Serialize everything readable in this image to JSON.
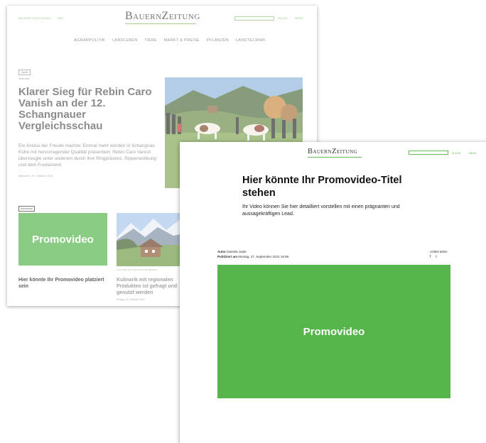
{
  "homepage": {
    "toplinks": [
      "BAUERN ZUSCHAUEN",
      "ABO"
    ],
    "logo": "BauernZeitung",
    "search_label": "SUCHE",
    "menu_label": "MENÜ",
    "nav": [
      "AGRARPOLITIK",
      "LANDLEBEN",
      "TIERE",
      "MARKT & PREISE",
      "PFLANZEN",
      "LANDTECHNIK"
    ],
    "featured": {
      "tag": "Zucht",
      "kicker": "Viehzucht",
      "title": "Klarer Sieg für Rebin Caro Vanish an der 12. Schangnauer Vergleichsschau",
      "lead": "Ein Anlass der Freude machte: Einmal mehr wurden in Schangnau Kühe mit hervorragender Qualität präsentiert. Rebin Caro Vanish überzeugte unter anderem durch ihre Ringpräsenz, Rippenwölbung und dem Fundament.",
      "date": "Mittwoch, 29. Oktober 2021"
    },
    "ad_tag": "Advertorial",
    "promo_label": "Promovideo",
    "promo_caption": "Hier könnte Ihr Promovideo platziert sein",
    "card2": {
      "credit": "Jorg Rusch (Foto Ferienhaus Schädlisfeld)",
      "title": "Kulinarik mit regionalen Produkten ist gefragt und genutzt werden",
      "date": "Freitag, 22. Oktober 2021"
    }
  },
  "article": {
    "logo": "BauernZeitung",
    "search_label": "SUCHE",
    "menu_label": "MENÜ",
    "title": "Hier könnte Ihr Promovideo-Titel stehen",
    "lead": "Ihr Video können Sie hier detailliert vorstellen mit einen prägnanten und aussagekräftigen Lead.",
    "author_label": "Autor",
    "author": "Daniela Joder",
    "published_label": "Publiziert am",
    "published": "Montag, 27. September 2021 15:56",
    "share_label": "Artikel teilen",
    "share_icons": [
      "f",
      "t"
    ],
    "promo_label": "Promovideo"
  },
  "colors": {
    "brand_green": "#55b44a",
    "accent_green": "#6cb85c"
  }
}
